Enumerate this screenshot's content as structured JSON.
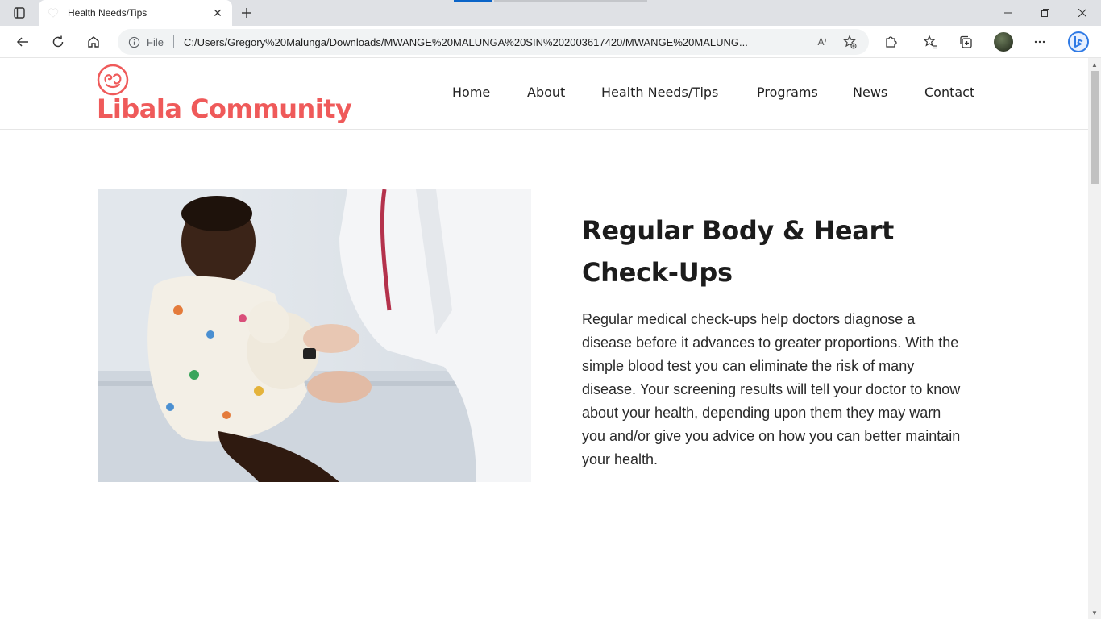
{
  "browser": {
    "tab_title": "Health Needs/Tips",
    "address_scheme": "File",
    "address_url": "C:/Users/Gregory%20Malunga/Downloads/MWANGE%20MALUNGA%20SIN%202003617420/MWANGE%20MALUNG...",
    "read_aloud_glyph": "A⁾"
  },
  "site": {
    "logo_text": "Libala Community",
    "brand_color": "#ef5a5a",
    "nav": [
      "Home",
      "About",
      "Health Needs/Tips",
      "Programs",
      "News",
      "Contact"
    ]
  },
  "article": {
    "title": "Regular Body & Heart Check-Ups",
    "body": "Regular medical check-ups help doctors diagnose a disease before it advances to greater proportions. With the simple blood test you can eliminate the risk of many disease. Your screening results will tell your doctor to know about your health, depending upon them they may warn you and/or give you advice on how you can better maintain your health."
  },
  "icons": {
    "tab_actions": "tab-actions-icon",
    "favicon": "heart-icon",
    "back": "back-arrow-icon",
    "refresh": "refresh-icon",
    "home": "home-icon",
    "info": "info-icon",
    "favorites_add": "star-plus-icon",
    "extensions": "puzzle-icon",
    "favorites": "favorites-icon",
    "collections": "collections-icon",
    "more": "more-icon",
    "bing": "bing-icon"
  }
}
